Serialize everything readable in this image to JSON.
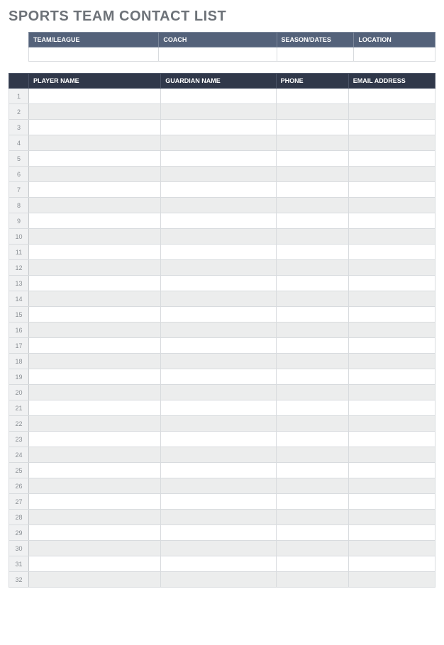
{
  "title": "SPORTS TEAM CONTACT LIST",
  "info": {
    "headers": {
      "team": "TEAM/LEAGUE",
      "coach": "COACH",
      "season": "SEASON/DATES",
      "location": "LOCATION"
    },
    "values": {
      "team": "",
      "coach": "",
      "season": "",
      "location": ""
    }
  },
  "main": {
    "headers": {
      "num": "",
      "player": "PLAYER NAME",
      "guardian": "GUARDIAN NAME",
      "phone": "PHONE",
      "email": "EMAIL ADDRESS"
    },
    "rows": [
      {
        "n": "1",
        "player": "",
        "guardian": "",
        "phone": "",
        "email": ""
      },
      {
        "n": "2",
        "player": "",
        "guardian": "",
        "phone": "",
        "email": ""
      },
      {
        "n": "3",
        "player": "",
        "guardian": "",
        "phone": "",
        "email": ""
      },
      {
        "n": "4",
        "player": "",
        "guardian": "",
        "phone": "",
        "email": ""
      },
      {
        "n": "5",
        "player": "",
        "guardian": "",
        "phone": "",
        "email": ""
      },
      {
        "n": "6",
        "player": "",
        "guardian": "",
        "phone": "",
        "email": ""
      },
      {
        "n": "7",
        "player": "",
        "guardian": "",
        "phone": "",
        "email": ""
      },
      {
        "n": "8",
        "player": "",
        "guardian": "",
        "phone": "",
        "email": ""
      },
      {
        "n": "9",
        "player": "",
        "guardian": "",
        "phone": "",
        "email": ""
      },
      {
        "n": "10",
        "player": "",
        "guardian": "",
        "phone": "",
        "email": ""
      },
      {
        "n": "11",
        "player": "",
        "guardian": "",
        "phone": "",
        "email": ""
      },
      {
        "n": "12",
        "player": "",
        "guardian": "",
        "phone": "",
        "email": ""
      },
      {
        "n": "13",
        "player": "",
        "guardian": "",
        "phone": "",
        "email": ""
      },
      {
        "n": "14",
        "player": "",
        "guardian": "",
        "phone": "",
        "email": ""
      },
      {
        "n": "15",
        "player": "",
        "guardian": "",
        "phone": "",
        "email": ""
      },
      {
        "n": "16",
        "player": "",
        "guardian": "",
        "phone": "",
        "email": ""
      },
      {
        "n": "17",
        "player": "",
        "guardian": "",
        "phone": "",
        "email": ""
      },
      {
        "n": "18",
        "player": "",
        "guardian": "",
        "phone": "",
        "email": ""
      },
      {
        "n": "19",
        "player": "",
        "guardian": "",
        "phone": "",
        "email": ""
      },
      {
        "n": "20",
        "player": "",
        "guardian": "",
        "phone": "",
        "email": ""
      },
      {
        "n": "21",
        "player": "",
        "guardian": "",
        "phone": "",
        "email": ""
      },
      {
        "n": "22",
        "player": "",
        "guardian": "",
        "phone": "",
        "email": ""
      },
      {
        "n": "23",
        "player": "",
        "guardian": "",
        "phone": "",
        "email": ""
      },
      {
        "n": "24",
        "player": "",
        "guardian": "",
        "phone": "",
        "email": ""
      },
      {
        "n": "25",
        "player": "",
        "guardian": "",
        "phone": "",
        "email": ""
      },
      {
        "n": "26",
        "player": "",
        "guardian": "",
        "phone": "",
        "email": ""
      },
      {
        "n": "27",
        "player": "",
        "guardian": "",
        "phone": "",
        "email": ""
      },
      {
        "n": "28",
        "player": "",
        "guardian": "",
        "phone": "",
        "email": ""
      },
      {
        "n": "29",
        "player": "",
        "guardian": "",
        "phone": "",
        "email": ""
      },
      {
        "n": "30",
        "player": "",
        "guardian": "",
        "phone": "",
        "email": ""
      },
      {
        "n": "31",
        "player": "",
        "guardian": "",
        "phone": "",
        "email": ""
      },
      {
        "n": "32",
        "player": "",
        "guardian": "",
        "phone": "",
        "email": ""
      }
    ]
  }
}
